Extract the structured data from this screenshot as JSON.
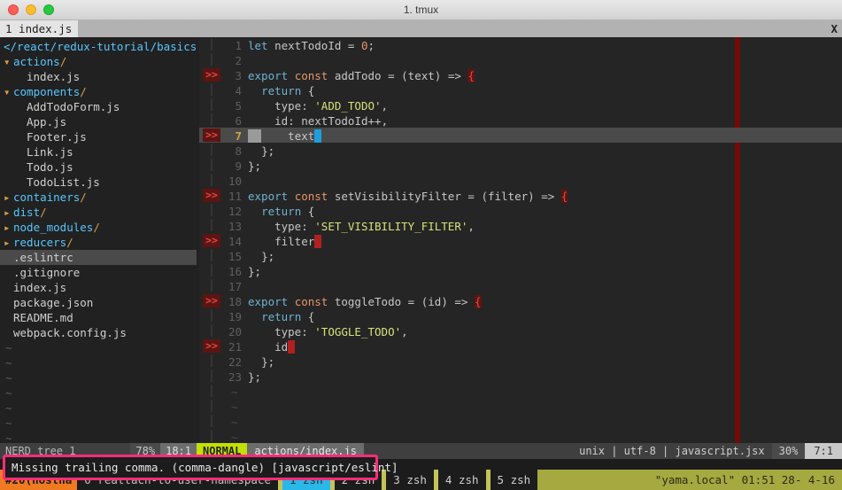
{
  "window": {
    "title": "1. tmux",
    "traffic_lights": [
      "close-light",
      "minimize-light",
      "maximize-light"
    ]
  },
  "tabline": {
    "active_tab": "1 index.js",
    "close_label": "X"
  },
  "file_tree": {
    "root": "</react/redux-tutorial/basics/",
    "items": [
      {
        "label": "actions/",
        "type": "dir-open",
        "indent": 0,
        "selected": false
      },
      {
        "label": "index.js",
        "type": "file",
        "indent": 1,
        "selected": false
      },
      {
        "label": "components/",
        "type": "dir-open",
        "indent": 0,
        "selected": false
      },
      {
        "label": "AddTodoForm.js",
        "type": "file",
        "indent": 1,
        "selected": false
      },
      {
        "label": "App.js",
        "type": "file",
        "indent": 1,
        "selected": false
      },
      {
        "label": "Footer.js",
        "type": "file",
        "indent": 1,
        "selected": false
      },
      {
        "label": "Link.js",
        "type": "file",
        "indent": 1,
        "selected": false
      },
      {
        "label": "Todo.js",
        "type": "file",
        "indent": 1,
        "selected": false
      },
      {
        "label": "TodoList.js",
        "type": "file",
        "indent": 1,
        "selected": false
      },
      {
        "label": "containers/",
        "type": "dir-closed",
        "indent": 0,
        "selected": false
      },
      {
        "label": "dist/",
        "type": "dir-closed",
        "indent": 0,
        "selected": false
      },
      {
        "label": "node_modules/",
        "type": "dir-closed",
        "indent": 0,
        "selected": false
      },
      {
        "label": "reducers/",
        "type": "dir-closed",
        "indent": 0,
        "selected": false
      },
      {
        "label": ".eslintrc",
        "type": "file",
        "indent": 0,
        "selected": true
      },
      {
        "label": ".gitignore",
        "type": "file",
        "indent": 0,
        "selected": false
      },
      {
        "label": "index.js",
        "type": "file",
        "indent": 0,
        "selected": false
      },
      {
        "label": "package.json",
        "type": "file",
        "indent": 0,
        "selected": false
      },
      {
        "label": "README.md",
        "type": "file",
        "indent": 0,
        "selected": false
      },
      {
        "label": "webpack.config.js",
        "type": "file",
        "indent": 0,
        "selected": false
      }
    ],
    "empty_marker": "~",
    "empty_rows": 7
  },
  "editor": {
    "sign_marker": ">>",
    "empty_marker": "~",
    "empty_rows": 4,
    "lines": [
      {
        "num": "1",
        "sign": false,
        "cursorline": false,
        "text": "let nextTodoId = 0;"
      },
      {
        "num": "2",
        "sign": false,
        "cursorline": false,
        "text": ""
      },
      {
        "num": "3",
        "sign": true,
        "cursorline": false,
        "text": "export const addTodo = (text) => {"
      },
      {
        "num": "4",
        "sign": false,
        "cursorline": false,
        "text": "  return {"
      },
      {
        "num": "5",
        "sign": false,
        "cursorline": false,
        "text": "    type: 'ADD_TODO',"
      },
      {
        "num": "6",
        "sign": false,
        "cursorline": false,
        "text": "    id: nextTodoId++,"
      },
      {
        "num": "7",
        "sign": true,
        "cursorline": true,
        "text": "    text"
      },
      {
        "num": "8",
        "sign": false,
        "cursorline": false,
        "text": "  };"
      },
      {
        "num": "9",
        "sign": false,
        "cursorline": false,
        "text": "};"
      },
      {
        "num": "10",
        "sign": false,
        "cursorline": false,
        "text": ""
      },
      {
        "num": "11",
        "sign": true,
        "cursorline": false,
        "text": "export const setVisibilityFilter = (filter) => {"
      },
      {
        "num": "12",
        "sign": false,
        "cursorline": false,
        "text": "  return {"
      },
      {
        "num": "13",
        "sign": false,
        "cursorline": false,
        "text": "    type: 'SET_VISIBILITY_FILTER',"
      },
      {
        "num": "14",
        "sign": true,
        "cursorline": false,
        "text": "    filter"
      },
      {
        "num": "15",
        "sign": false,
        "cursorline": false,
        "text": "  };"
      },
      {
        "num": "16",
        "sign": false,
        "cursorline": false,
        "text": "};"
      },
      {
        "num": "17",
        "sign": false,
        "cursorline": false,
        "text": ""
      },
      {
        "num": "18",
        "sign": true,
        "cursorline": false,
        "text": "export const toggleTodo = (id) => {"
      },
      {
        "num": "19",
        "sign": false,
        "cursorline": false,
        "text": "  return {"
      },
      {
        "num": "20",
        "sign": false,
        "cursorline": false,
        "text": "    type: 'TOGGLE_TODO',"
      },
      {
        "num": "21",
        "sign": true,
        "cursorline": false,
        "text": "    id"
      },
      {
        "num": "22",
        "sign": false,
        "cursorline": false,
        "text": "  };"
      },
      {
        "num": "23",
        "sign": false,
        "cursorline": false,
        "text": "};"
      }
    ]
  },
  "statusline_left": {
    "buffer_name": "NERD_tree_1",
    "percent": "78%",
    "position": "18:1"
  },
  "statusline_right": {
    "mode": "NORMAL",
    "filename": "actions/index.js",
    "fileformat": "unix",
    "encoding": "utf-8",
    "filetype": "javascript.jsx",
    "percent": "30%",
    "position": "7:1"
  },
  "error_message": {
    "text": "Missing trailing comma. (comma-dangle) [javascript/eslint]"
  },
  "tmux": {
    "session": "#20(hostna",
    "current": "0 reattach-to-user-namespace",
    "windows": [
      {
        "label": "1 zsh",
        "active": true
      },
      {
        "label": "2 zsh",
        "active": false
      },
      {
        "label": "3 zsh",
        "active": false
      },
      {
        "label": "4 zsh",
        "active": false
      },
      {
        "label": "5 zsh",
        "active": false
      }
    ],
    "right": "\"yama.local\" 01:51 28- 4-16"
  },
  "colors": {
    "accent_pink": "#ff2d78",
    "mode_green": "#c3e000",
    "colorcolumn_red": "#740a05",
    "cursor_blue": "#1f9ede",
    "dir_blue": "#57c7ff",
    "slash_orange": "#d7a043"
  }
}
